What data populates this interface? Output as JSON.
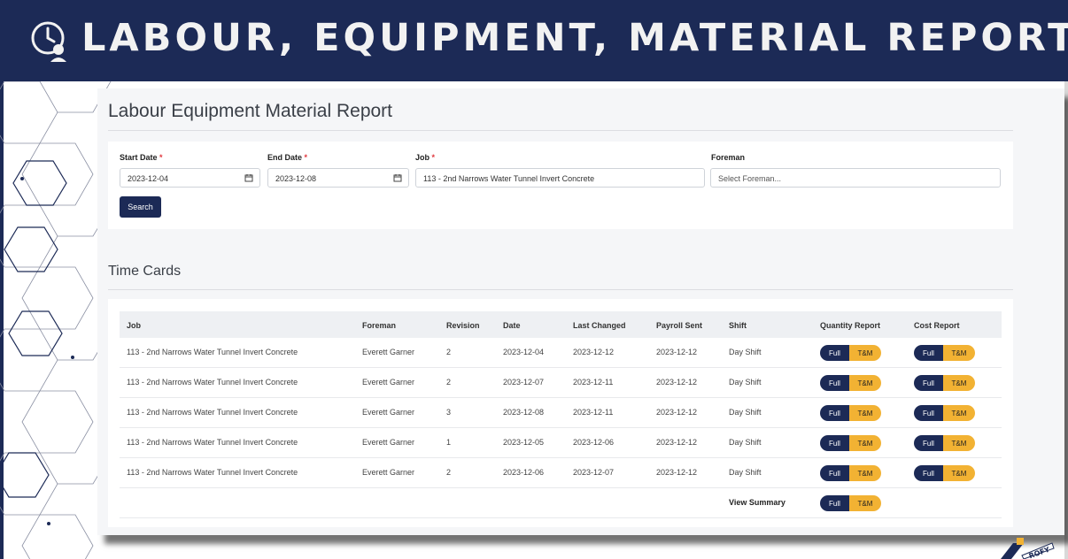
{
  "banner": {
    "title": "LABOUR, EQUIPMENT, MATERIAL REPORT",
    "icon": "clock-person-icon"
  },
  "page": {
    "title": "Labour Equipment Material Report"
  },
  "filters": {
    "start_date": {
      "label": "Start Date",
      "required_mark": "*",
      "value": "2023-12-04"
    },
    "end_date": {
      "label": "End Date",
      "required_mark": "*",
      "value": "2023-12-08"
    },
    "job": {
      "label": "Job",
      "required_mark": "*",
      "value": "113 - 2nd Narrows Water Tunnel Invert Concrete"
    },
    "foreman": {
      "label": "Foreman",
      "placeholder": "Select Foreman..."
    },
    "search_label": "Search"
  },
  "time_cards": {
    "title": "Time Cards",
    "columns": [
      "Job",
      "Foreman",
      "Revision",
      "Date",
      "Last Changed",
      "Payroll Sent",
      "Shift",
      "Quantity Report",
      "Cost Report"
    ],
    "rows": [
      {
        "job": "113 - 2nd Narrows Water Tunnel Invert Concrete",
        "foreman": "Everett Garner",
        "revision": "2",
        "date": "2023-12-04",
        "last_changed": "2023-12-12",
        "payroll_sent": "2023-12-12",
        "shift": "Day Shift"
      },
      {
        "job": "113 - 2nd Narrows Water Tunnel Invert Concrete",
        "foreman": "Everett Garner",
        "revision": "2",
        "date": "2023-12-07",
        "last_changed": "2023-12-11",
        "payroll_sent": "2023-12-12",
        "shift": "Day Shift"
      },
      {
        "job": "113 - 2nd Narrows Water Tunnel Invert Concrete",
        "foreman": "Everett Garner",
        "revision": "3",
        "date": "2023-12-08",
        "last_changed": "2023-12-11",
        "payroll_sent": "2023-12-12",
        "shift": "Day Shift"
      },
      {
        "job": "113 - 2nd Narrows Water Tunnel Invert Concrete",
        "foreman": "Everett Garner",
        "revision": "1",
        "date": "2023-12-05",
        "last_changed": "2023-12-06",
        "payroll_sent": "2023-12-12",
        "shift": "Day Shift"
      },
      {
        "job": "113 - 2nd Narrows Water Tunnel Invert Concrete",
        "foreman": "Everett Garner",
        "revision": "2",
        "date": "2023-12-06",
        "last_changed": "2023-12-07",
        "payroll_sent": "2023-12-12",
        "shift": "Day Shift"
      }
    ],
    "full_label": "Full",
    "tm_label": "T&M",
    "view_summary_label": "View Summary"
  },
  "logo": {
    "text": "ROFY"
  },
  "colors": {
    "navy": "#1c2a56",
    "gold": "#f2b233",
    "required": "#e0383e"
  }
}
